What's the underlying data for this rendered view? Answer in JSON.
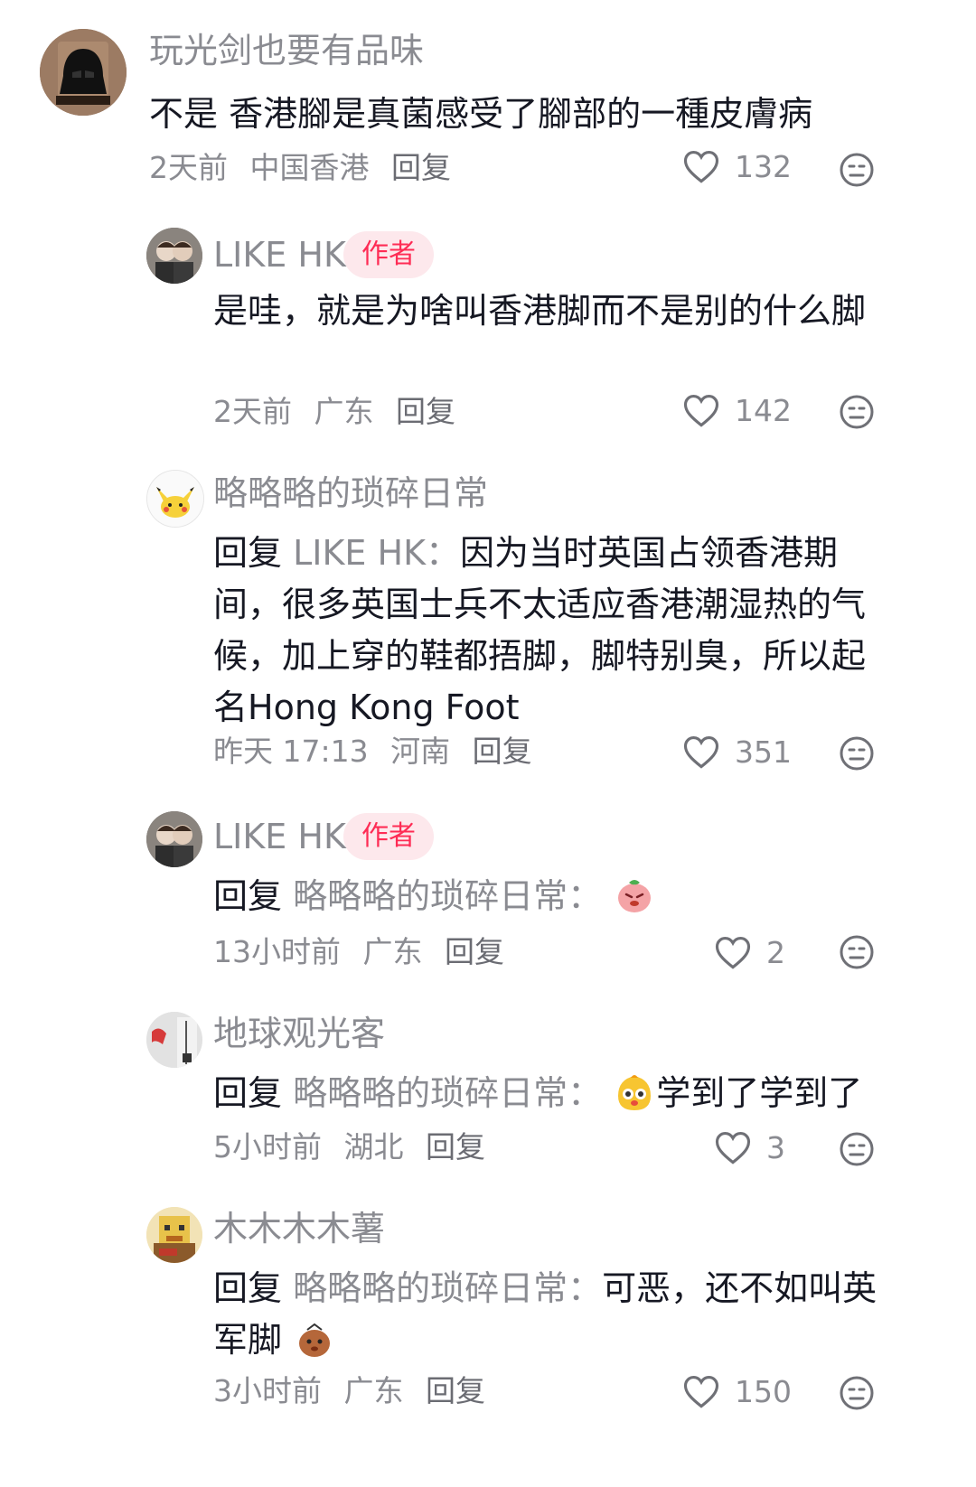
{
  "comments": [
    {
      "username": "玩光剑也要有品味",
      "text": "不是 香港腳是真菌感受了腳部的一種皮膚病",
      "time": "2天前",
      "location": "中国香港",
      "reply": "回复",
      "likes": "132"
    },
    {
      "username": "LIKE HK",
      "badge": "作者",
      "text": "是哇，就是为啥叫香港脚而不是别的什么脚",
      "time": "2天前",
      "location": "广东",
      "reply": "回复",
      "likes": "142"
    },
    {
      "username": "略略略的琐碎日常",
      "reply_prefix": "回复",
      "mention": "LIKE HK：",
      "text": "因为当时英国占领香港期间，很多英国士兵不太适应香港潮湿热的气候，加上穿的鞋都捂脚，脚特别臭，所以起名Hong Kong Foot",
      "time": "昨天 17:13",
      "location": "河南",
      "reply": "回复",
      "likes": "351"
    },
    {
      "username": "LIKE HK",
      "badge": "作者",
      "reply_prefix": "回复",
      "mention": "略略略的琐碎日常：",
      "time": "13小时前",
      "location": "广东",
      "reply": "回复",
      "likes": "2"
    },
    {
      "username": "地球观光客",
      "reply_prefix": "回复",
      "mention": "略略略的琐碎日常：",
      "text": "学到了学到了",
      "time": "5小时前",
      "location": "湖北",
      "reply": "回复",
      "likes": "3"
    },
    {
      "username": "木木木木薯",
      "reply_prefix": "回复",
      "mention": "略略略的琐碎日常：",
      "text": "可恶，还不如叫英军脚",
      "time": "3小时前",
      "location": "广东",
      "reply": "回复",
      "likes": "150"
    }
  ]
}
